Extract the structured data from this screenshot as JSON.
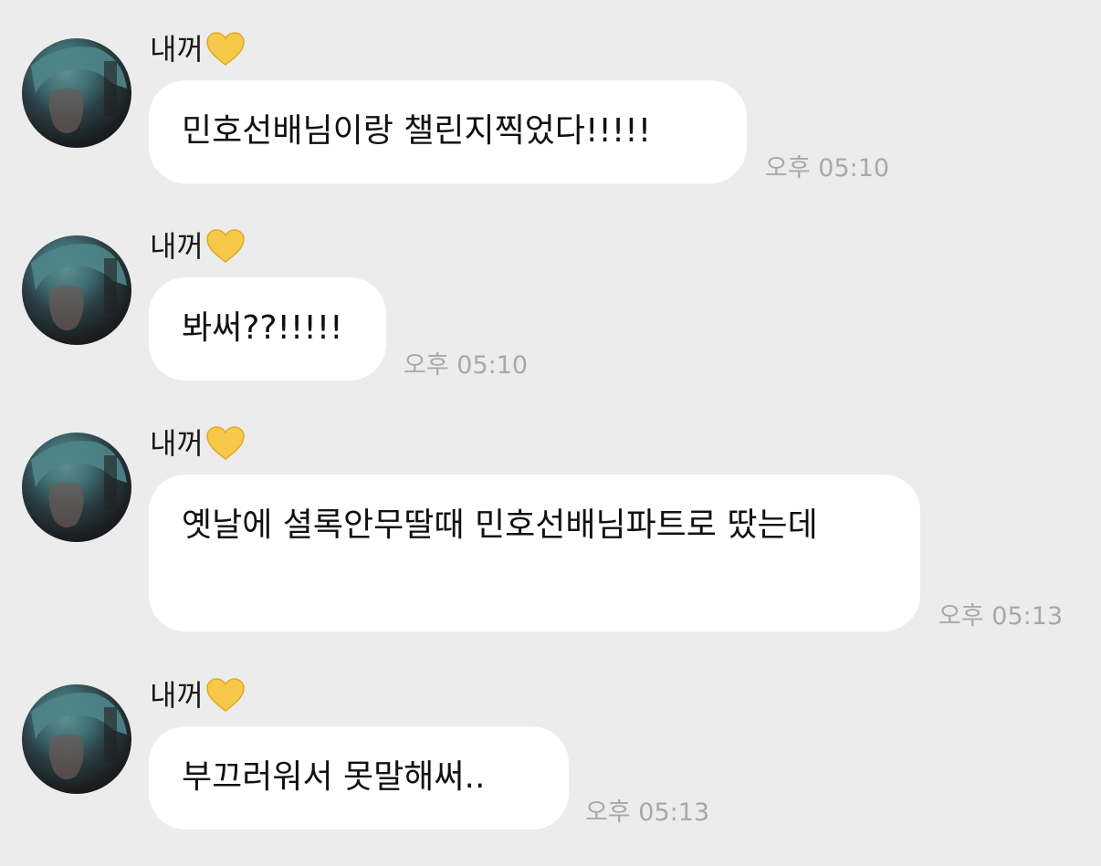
{
  "messages": [
    {
      "sender": "내꺼",
      "sender_emoji": "yellow-heart-icon",
      "text": "민호선배님이랑 챌린지찍었다!!!!!",
      "time": "오후 05:10"
    },
    {
      "sender": "내꺼",
      "sender_emoji": "yellow-heart-icon",
      "text": "봐써??!!!!!",
      "time": "오후 05:10"
    },
    {
      "sender": "내꺼",
      "sender_emoji": "yellow-heart-icon",
      "text": "옛날에 셜록안무딸때 민호선배님파트로 땄는데",
      "time": "오후 05:13"
    },
    {
      "sender": "내꺼",
      "sender_emoji": "yellow-heart-icon",
      "text": "부끄러워서 못말해써..",
      "time": "오후 05:13"
    }
  ],
  "colors": {
    "background": "#ececec",
    "bubble": "#ffffff",
    "time_text": "#a8a8a8",
    "heart": "#f7c948"
  }
}
